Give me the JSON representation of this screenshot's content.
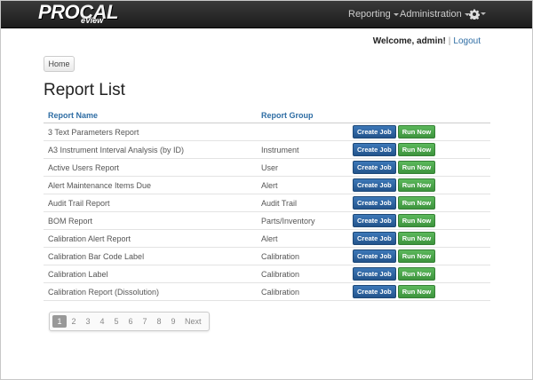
{
  "header": {
    "brand_pro": "PRO",
    "brand_cal": "CAL",
    "brand_sub": "eView",
    "menus": [
      "Reporting",
      "Administration"
    ],
    "settings_icon": "gear-icon"
  },
  "user": {
    "welcome": "Welcome, admin!",
    "separator": "|",
    "logout": "Logout"
  },
  "breadcrumb": {
    "home": "Home"
  },
  "page": {
    "title": "Report List"
  },
  "table": {
    "columns": [
      "Report Name",
      "Report Group"
    ],
    "create_label": "Create Job",
    "run_label": "Run Now",
    "rows": [
      {
        "name": "3 Text Parameters Report",
        "group": ""
      },
      {
        "name": "A3 Instrument Interval Analysis (by ID)",
        "group": "Instrument"
      },
      {
        "name": "Active Users Report",
        "group": "User"
      },
      {
        "name": "Alert Maintenance Items Due",
        "group": "Alert"
      },
      {
        "name": "Audit Trail Report",
        "group": "Audit Trail"
      },
      {
        "name": "BOM Report",
        "group": "Parts/Inventory"
      },
      {
        "name": "Calibration Alert Report",
        "group": "Alert"
      },
      {
        "name": "Calibration Bar Code Label",
        "group": "Calibration"
      },
      {
        "name": "Calibration Label",
        "group": "Calibration"
      },
      {
        "name": "Calibration Report (Dissolution)",
        "group": "Calibration"
      }
    ]
  },
  "pagination": {
    "pages": [
      "1",
      "2",
      "3",
      "4",
      "5",
      "6",
      "7",
      "8",
      "9"
    ],
    "active": "1",
    "next": "Next"
  }
}
